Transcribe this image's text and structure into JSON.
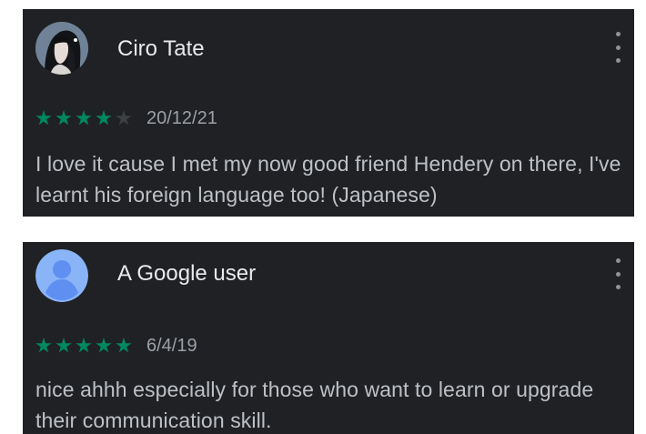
{
  "reviews": [
    {
      "user_name": "Ciro Tate",
      "avatar_icon": "profile-photo",
      "rating": 4,
      "max_rating": 5,
      "date": "20/12/21",
      "text": "I love it cause I met my now good friend Hendery on there, I've learnt his foreign language too! (Japanese)",
      "menu_icon": "more-vert-icon"
    },
    {
      "user_name": "A Google user",
      "avatar_icon": "default-user-avatar-icon",
      "rating": 5,
      "max_rating": 5,
      "date": "6/4/19",
      "text": "nice ahhh especially for those who want to learn or upgrade their communication skill.",
      "menu_icon": "more-vert-icon"
    }
  ],
  "colors": {
    "card_background": "#202124",
    "star_filled": "#01875f",
    "star_empty": "#3c4043",
    "name_text": "#e8eaed",
    "body_text": "#bdc1c6",
    "date_text": "#9aa0a6",
    "avatar_default": "#8ab4f8"
  }
}
